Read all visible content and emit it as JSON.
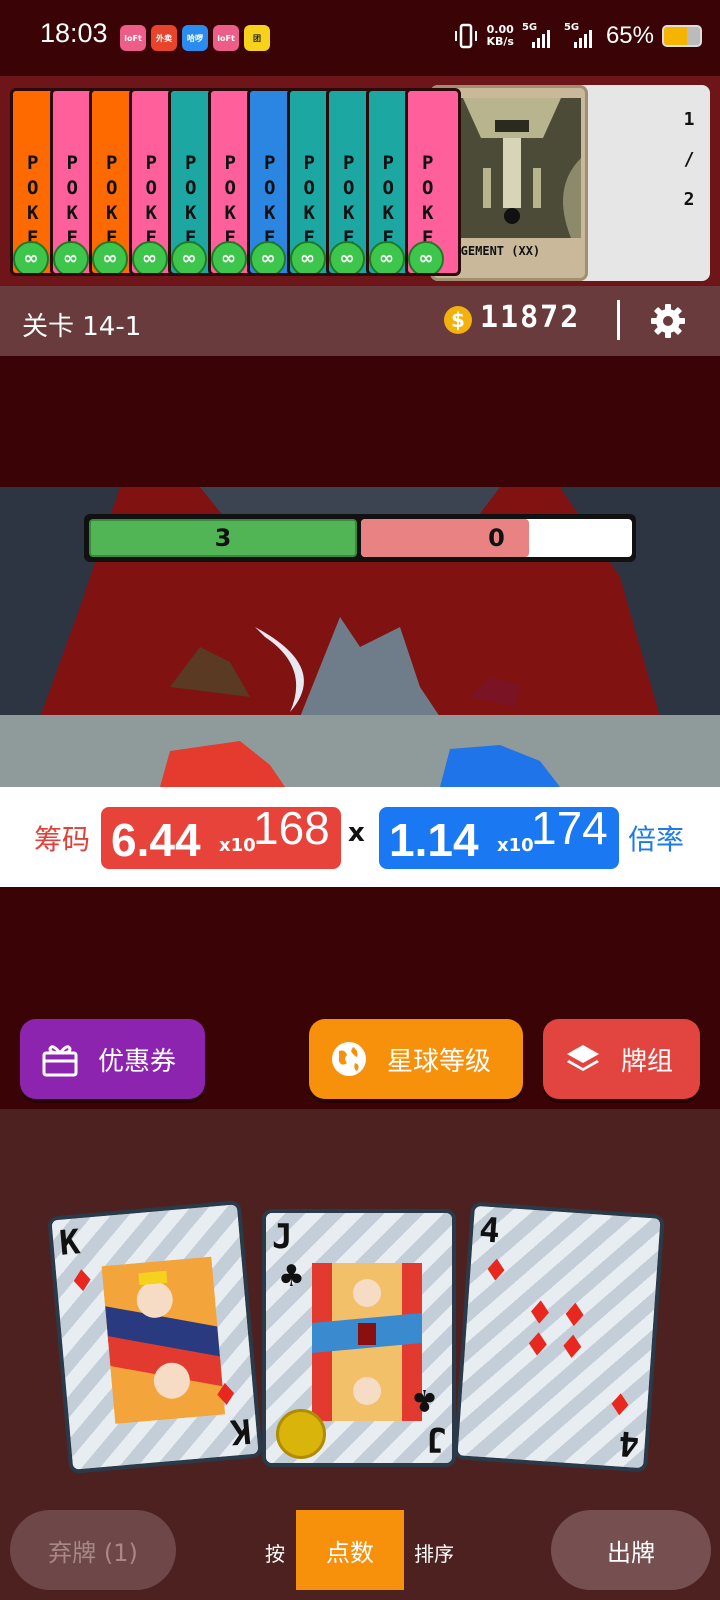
{
  "status_bar": {
    "time": "18:03",
    "apps": [
      {
        "icon": "lofter-app-icon",
        "label": "loFt",
        "color": "#ec5d88"
      },
      {
        "icon": "takeout-app-icon",
        "label": "外卖",
        "color": "#e8442c"
      },
      {
        "icon": "haluo-app-icon",
        "label": "哈啰",
        "color": "#2b8cf0"
      },
      {
        "icon": "lofter2-app-icon",
        "label": "loFt",
        "color": "#ec5d88"
      },
      {
        "icon": "meituan-app-icon",
        "label": "团",
        "color": "#f7d21c"
      }
    ],
    "net_speed": "0.00",
    "net_unit": "KB/s",
    "sim1": "5G",
    "sim2": "5G",
    "battery": "65%",
    "battery_level": 0.65
  },
  "jokers": {
    "cards": [
      {
        "color": "#ff6a00",
        "text": "P\nO\nK\nE",
        "badge": "∞"
      },
      {
        "color": "#ff5f9a",
        "text": "P\nO\nK\nE",
        "badge": "∞"
      },
      {
        "color": "#ff6a00",
        "text": "P\nO\nK\nE",
        "badge": "∞"
      },
      {
        "color": "#ff5f9a",
        "text": "P\nO\nK\nE",
        "badge": "∞"
      },
      {
        "color": "#1ca7a3",
        "text": "P\nO\nK\nE",
        "badge": "∞"
      },
      {
        "color": "#ff5f9a",
        "text": "P\nO\nK\nE",
        "badge": "∞"
      },
      {
        "color": "#2a86e0",
        "text": "P\nO\nK\nE",
        "badge": "∞"
      },
      {
        "color": "#1ca7a3",
        "text": "P\nO\nK\nE",
        "badge": "∞"
      },
      {
        "color": "#1ca7a3",
        "text": "P\nO\nK\nE",
        "badge": "∞"
      },
      {
        "color": "#1ca7a3",
        "text": "P\nO\nK\nE",
        "badge": "∞"
      },
      {
        "color": "#ff5f9a",
        "text": "P\nO\nK\nE",
        "badge": "∞"
      }
    ],
    "detail": {
      "name": "JUDGEMENT (XX)",
      "count_current": "1",
      "count_sep": "/",
      "count_total": "2"
    }
  },
  "level_bar": {
    "level": "关卡 14-1",
    "coins": "11872",
    "coin_symbol": "$"
  },
  "battle": {
    "player_hp": "3",
    "enemy_hp": "0",
    "enemy_hp_fill": 0.62,
    "colors": {
      "player": "#52b555",
      "enemy": "#e98283"
    }
  },
  "score": {
    "chips_label": "筹码",
    "chips_mantissa": "6.44",
    "chips_x10": "x10",
    "chips_exp": "168",
    "times": "x",
    "mult_mantissa": "1.14",
    "mult_x10": "x10",
    "mult_exp": "174",
    "mult_label": "倍率"
  },
  "buttons": {
    "coupon": "优惠券",
    "planet": "星球等级",
    "deck": "牌组"
  },
  "hand": [
    {
      "rank": "K",
      "suit": "♦",
      "suit_color": "#e8281e"
    },
    {
      "rank": "J",
      "suit": "♣",
      "suit_color": "#111111"
    },
    {
      "rank": "4",
      "suit": "♦",
      "suit_color": "#e8281e"
    }
  ],
  "bottom": {
    "discard": "弃牌 (1)",
    "sort_prefix": "按",
    "sort_mode": "点数",
    "sort_suffix": "排序",
    "play": "出牌"
  }
}
